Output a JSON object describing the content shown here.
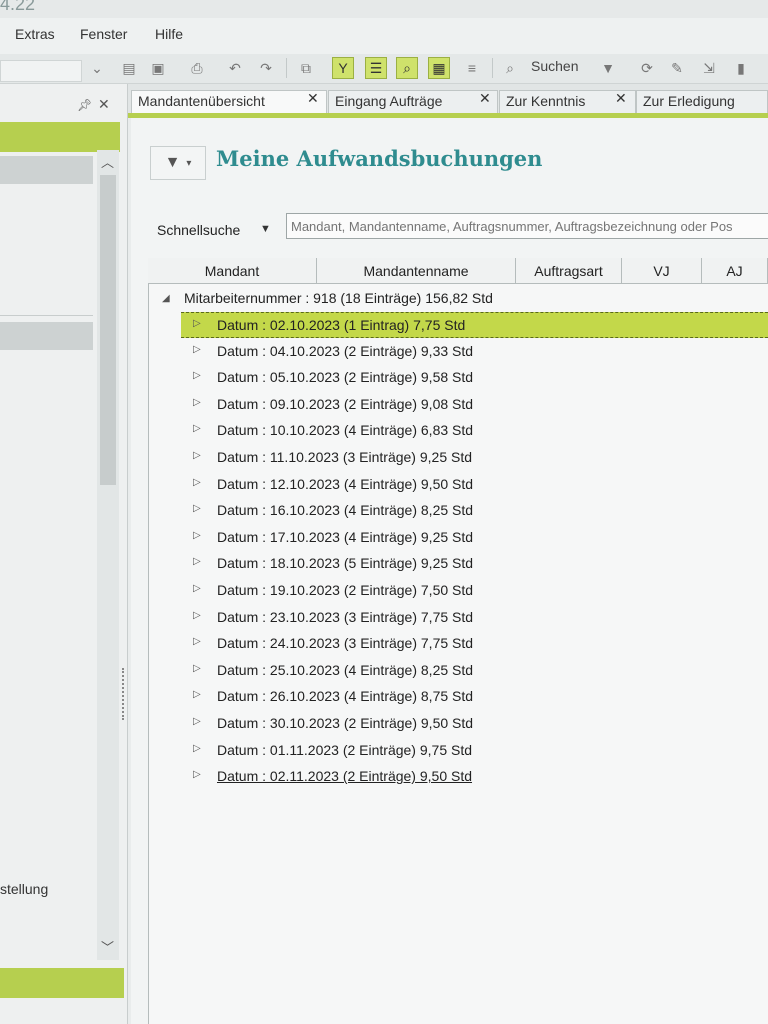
{
  "app": {
    "version": "4.22"
  },
  "menu": {
    "items": [
      "Extras",
      "Fenster",
      "Hilfe"
    ]
  },
  "toolbar": {
    "search_label": "Suchen"
  },
  "left_panel": {
    "item_text": "stellung"
  },
  "tabs": [
    {
      "label": "Mandantenübersicht",
      "active": true
    },
    {
      "label": "Eingang Aufträge",
      "active": false
    },
    {
      "label": "Zur Kenntnis",
      "active": false
    },
    {
      "label": "Zur Erledigung",
      "active": false
    }
  ],
  "page": {
    "title": "Meine Aufwandsbuchungen"
  },
  "quick_search": {
    "label": "Schnellsuche",
    "placeholder": "Mandant, Mandantenname, Auftragsnummer, Auftragsbezeichnung oder Pos"
  },
  "grid": {
    "columns": [
      "Mandant",
      "Mandantenname",
      "Auftragsart",
      "VJ",
      "AJ"
    ],
    "group_label": "Mitarbeiternummer : 918 (18 Einträge) 156,82 Std",
    "rows": [
      "Datum : 02.10.2023 (1 Eintrag) 7,75 Std",
      "Datum : 04.10.2023 (2 Einträge) 9,33 Std",
      "Datum : 05.10.2023 (2 Einträge) 9,58 Std",
      "Datum : 09.10.2023 (2 Einträge) 9,08 Std",
      "Datum : 10.10.2023 (4 Einträge) 6,83 Std",
      "Datum : 11.10.2023 (3 Einträge) 9,25 Std",
      "Datum : 12.10.2023 (4 Einträge) 9,50 Std",
      "Datum : 16.10.2023 (4 Einträge) 8,25 Std",
      "Datum : 17.10.2023 (4 Einträge) 9,25 Std",
      "Datum : 18.10.2023 (5 Einträge) 9,25 Std",
      "Datum : 19.10.2023 (2 Einträge) 7,50 Std",
      "Datum : 23.10.2023 (3 Einträge) 7,75 Std",
      "Datum : 24.10.2023 (3 Einträge) 7,75 Std",
      "Datum : 25.10.2023 (4 Einträge) 8,25 Std",
      "Datum : 26.10.2023 (4 Einträge) 8,75 Std",
      "Datum : 30.10.2023 (2 Einträge) 9,50 Std",
      "Datum : 01.11.2023 (2 Einträge) 9,75 Std",
      "Datum : 02.11.2023 (2 Einträge) 9,50 Std"
    ],
    "selected_row": 0
  },
  "colors": {
    "accent": "#b6cf4f",
    "selection": "#c3d84a",
    "title": "#2f8c8f"
  }
}
